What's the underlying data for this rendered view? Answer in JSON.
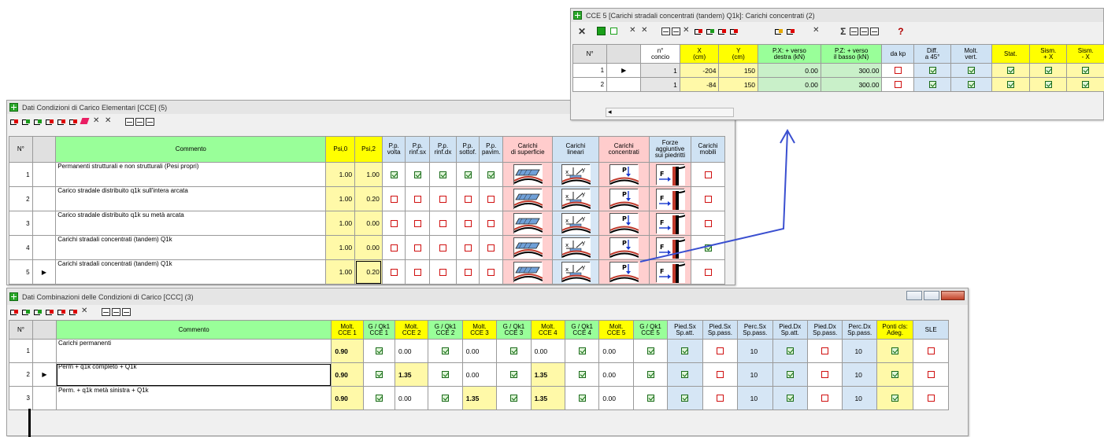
{
  "cce5": {
    "title": "CCE 5 [Carichi stradali concentrati (tandem) Q1k]: Carichi concentrati (2)",
    "toolbar": {
      "close": "✕",
      "sum": "Σ",
      "help": "?"
    },
    "columns": [
      "N°",
      "",
      "n°\nconcio",
      "X\n(cm)",
      "Y\n(cm)",
      "P.X: + verso\ndestra (kN)",
      "P.Z: + verso\nil basso (kN)",
      "da kp",
      "Diff.\na 45°",
      "Molt.\nvert.",
      "Stat.",
      "Sism.\n+ X",
      "Sism.\n- X"
    ],
    "rows": [
      {
        "n": "1",
        "pointer": "▶",
        "concio": "1",
        "x": "-204",
        "y": "150",
        "px": "0.00",
        "pz": "300.00",
        "dakp": false,
        "diff": true,
        "molt": true,
        "stat": true,
        "sx": true,
        "smx": true
      },
      {
        "n": "2",
        "pointer": "",
        "concio": "1",
        "x": "-84",
        "y": "150",
        "px": "0.00",
        "pz": "300.00",
        "dakp": false,
        "diff": true,
        "molt": true,
        "stat": true,
        "sx": true,
        "smx": true
      }
    ],
    "scroll_left": "◂"
  },
  "cce": {
    "title": "Dati Condizioni di Carico Elementari [CCE] (5)",
    "columns": [
      "N°",
      "",
      "Commento",
      "Psi,0",
      "Psi,2",
      "P.p.\nvolta",
      "P.p.\nrinf.sx",
      "P.p.\nrinf.dx",
      "P.p.\nsottof.",
      "P.p.\npavim.",
      "Carichi\ndi superficie",
      "Carichi\nlineari",
      "Carichi\nconcentrati",
      "Forze\naggiuntive\nsui piedritti",
      "Carichi\nmobili"
    ],
    "rows": [
      {
        "n": "1",
        "pointer": "",
        "commento": "Permanenti strutturali e non strutturali (Pesi propri)",
        "psi0": "1.00",
        "psi2": "1.00",
        "c": [
          true,
          true,
          true,
          true,
          true
        ],
        "mobili": false
      },
      {
        "n": "2",
        "pointer": "",
        "commento": "Carico stradale distribuito q1k sull'intera arcata",
        "psi0": "1.00",
        "psi2": "0.20",
        "c": [
          false,
          false,
          false,
          false,
          false
        ],
        "mobili": false
      },
      {
        "n": "3",
        "pointer": "",
        "commento": "Carico stradale distribuito q1k su metà arcata",
        "psi0": "1.00",
        "psi2": "0.00",
        "c": [
          false,
          false,
          false,
          false,
          false
        ],
        "mobili": false
      },
      {
        "n": "4",
        "pointer": "",
        "commento": "Carichi stradali concentrati (tandem) Q1k",
        "psi0": "1.00",
        "psi2": "0.00",
        "c": [
          false,
          false,
          false,
          false,
          false
        ],
        "mobili": true
      },
      {
        "n": "5",
        "pointer": "▶",
        "commento": "Carichi stradali concentrati (tandem) Q1k",
        "psi0": "1.00",
        "psi2": "0.20",
        "c": [
          false,
          false,
          false,
          false,
          false
        ],
        "mobili": false
      }
    ],
    "icon_labels": {
      "force": "F",
      "point": "P",
      "x": "x",
      "y": "y"
    }
  },
  "ccc": {
    "title": "Dati Combinazioni delle Condizioni di Carico [CCC] (3)",
    "columns": [
      "N°",
      "",
      "Commento",
      "Molt.\nCCE 1",
      "G / Qk1\nCCE 1",
      "Molt.\nCCE 2",
      "G / Qk1\nCCE 2",
      "Molt.\nCCE 3",
      "G / Qk1\nCCE 3",
      "Molt.\nCCE 4",
      "G / Qk1\nCCE 4",
      "Molt.\nCCE 5",
      "G / Qk1\nCCE 5",
      "Pied.Sx\nSp.att.",
      "Pied.Sx\nSp.pass.",
      "Perc.Sx\nSp.pass.",
      "Pied.Dx\nSp.att.",
      "Pied.Dx\nSp.pass.",
      "Perc.Dx\nSp.pass.",
      "Ponti cls:\nAdeg.",
      "SLE"
    ],
    "rows": [
      {
        "n": "1",
        "pointer": "",
        "commento": "Carichi permanenti",
        "m1": "0.90",
        "g1": true,
        "m2": "0.00",
        "g2": true,
        "m3": "0.00",
        "g3": true,
        "m4": "0.00",
        "g4": true,
        "m5": "0.00",
        "g5": true,
        "psa": true,
        "psp": false,
        "pcsx": "10",
        "pda": true,
        "pdp": false,
        "pcdx": "10",
        "ponti": true,
        "sle": false
      },
      {
        "n": "2",
        "pointer": "▶",
        "commento": "Perm + q1k completo + Q1k",
        "m1": "0.90",
        "g1": true,
        "m2": "1.35",
        "g2": true,
        "m3": "0.00",
        "g3": true,
        "m4": "1.35",
        "g4": true,
        "m5": "0.00",
        "g5": true,
        "psa": true,
        "psp": false,
        "pcsx": "10",
        "pda": true,
        "pdp": false,
        "pcdx": "10",
        "ponti": true,
        "sle": false
      },
      {
        "n": "3",
        "pointer": "",
        "commento": "Perm. + q1k metà sinistra + Q1k",
        "m1": "0.90",
        "g1": true,
        "m2": "0.00",
        "g2": true,
        "m3": "1.35",
        "g3": true,
        "m4": "1.35",
        "g4": true,
        "m5": "0.00",
        "g5": true,
        "psa": true,
        "psp": false,
        "pcsx": "10",
        "pda": true,
        "pdp": false,
        "pcdx": "10",
        "ponti": true,
        "sle": false
      }
    ]
  },
  "colors": {
    "yellow": "#ffff00",
    "green": "#99ff99",
    "blue": "#cfe2f3",
    "pink": "#ffcccc",
    "arrow": "#3a4fd0"
  }
}
